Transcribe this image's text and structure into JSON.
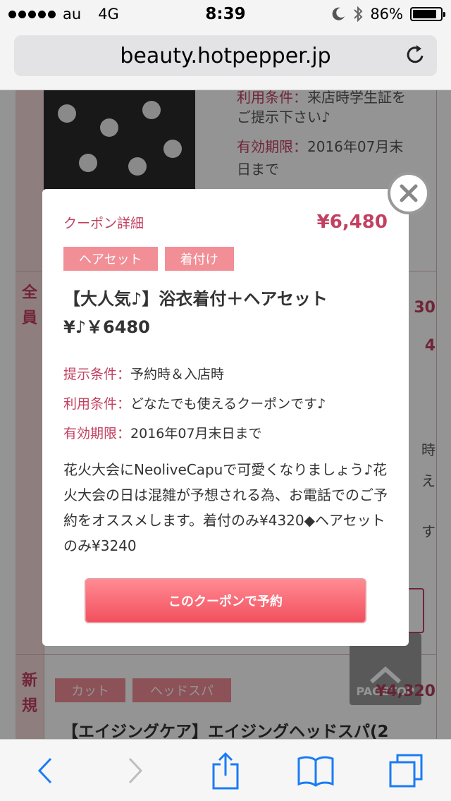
{
  "status": {
    "carrier": "au",
    "network": "4G",
    "time": "8:39",
    "battery": "86%",
    "battery_level": 0.86
  },
  "browser": {
    "url": "beauty.hotpepper.jp"
  },
  "background_page": {
    "label_conditions": "利用条件：",
    "conditions_text": "来店時学生証を",
    "conditions_text2": "ご提示下さい♪",
    "label_validity": "有効期限：",
    "validity_text": "2016年07月末",
    "validity_text2": "日まで",
    "side_badge_1": "全",
    "side_badge_2": "員",
    "side_badge_3": "新",
    "side_badge_4": "規",
    "tag_cut": "カット",
    "tag_headspa": "ヘッドスパ",
    "next_title": "【エイジングケア】エイジングヘッドスパ(2",
    "right_frag_1": "30",
    "right_frag_2": "4",
    "right_frag_3": "時",
    "right_frag_4": "え",
    "right_frag_5": "す",
    "pagetop": "PAGETOP",
    "pagetop_price": "¥4,320"
  },
  "modal": {
    "header_label": "クーポン詳細",
    "price": "¥6,480",
    "tags": [
      "ヘアセット",
      "着付け"
    ],
    "title": "【大人気♪】浴衣着付＋ヘアセット¥♪￥6480",
    "conditions": [
      {
        "label": "提示条件：",
        "value": "予約時＆入店時"
      },
      {
        "label": "利用条件：",
        "value": "どなたでも使えるクーポンです♪"
      },
      {
        "label": "有効期限：",
        "value": "2016年07月末日まで"
      }
    ],
    "description": "花火大会にNeoliveCapuで可愛くなりましょう♪花火大会の日は混雑が予想される為、お電話でのご予約をオススメします。着付のみ¥4320◆ヘアセットのみ¥3240",
    "reserve_button": "このクーポンで予約"
  },
  "toolbar": {
    "icons": [
      "back-icon",
      "forward-icon",
      "share-icon",
      "bookmarks-icon",
      "tabs-icon"
    ]
  }
}
